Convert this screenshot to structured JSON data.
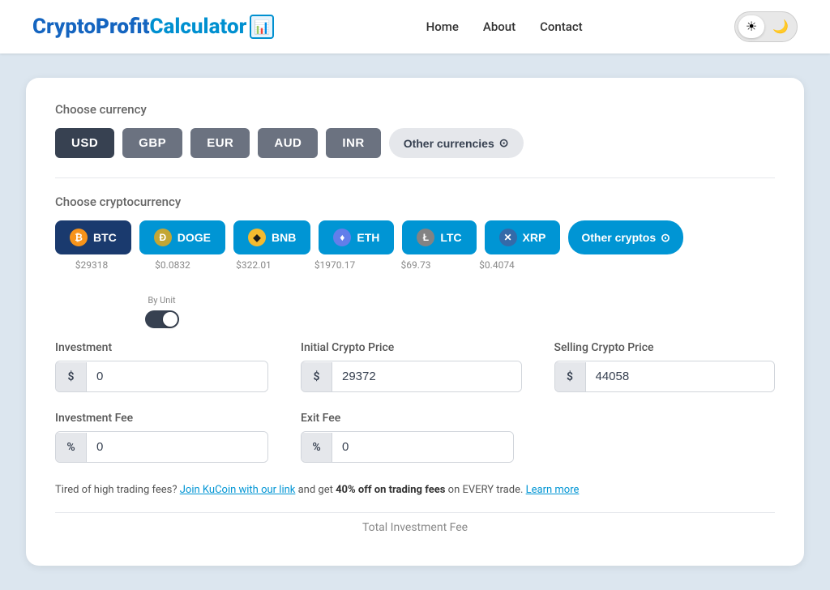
{
  "header": {
    "logo": {
      "crypto": "Crypto",
      "profit": "Profit",
      "calculator": "Calculator",
      "icon": "🖩"
    },
    "nav": [
      {
        "id": "home",
        "label": "Home"
      },
      {
        "id": "about",
        "label": "About"
      },
      {
        "id": "contact",
        "label": "Contact"
      }
    ],
    "theme": {
      "light_icon": "☀",
      "dark_icon": "🌙"
    }
  },
  "currency_section": {
    "label": "Choose currency",
    "buttons": [
      {
        "id": "usd",
        "label": "USD",
        "active": true
      },
      {
        "id": "gbp",
        "label": "GBP",
        "active": false
      },
      {
        "id": "eur",
        "label": "EUR",
        "active": false
      },
      {
        "id": "aud",
        "label": "AUD",
        "active": false
      },
      {
        "id": "inr",
        "label": "INR",
        "active": false
      }
    ],
    "other_label": "Other currencies",
    "other_icon": "⊙"
  },
  "crypto_section": {
    "label": "Choose cryptocurrency",
    "coins": [
      {
        "id": "btc",
        "label": "BTC",
        "price": "$29318",
        "icon": "₿",
        "active": true
      },
      {
        "id": "doge",
        "label": "DOGE",
        "price": "$0.0832",
        "icon": "D",
        "active": false
      },
      {
        "id": "bnb",
        "label": "BNB",
        "price": "$322.01",
        "icon": "◆",
        "active": false
      },
      {
        "id": "eth",
        "label": "ETH",
        "price": "$1970.17",
        "icon": "♦",
        "active": false
      },
      {
        "id": "ltc",
        "label": "LTC",
        "price": "$69.73",
        "icon": "Ł",
        "active": false
      },
      {
        "id": "xrp",
        "label": "XRP",
        "price": "$0.4074",
        "icon": "✕",
        "active": false
      }
    ],
    "other_label": "Other cryptos",
    "other_icon": "⊙"
  },
  "investment": {
    "by_unit_label": "By Unit",
    "label": "Investment",
    "prefix": "$",
    "value": "0",
    "initial_price_label": "Initial Crypto Price",
    "initial_price_prefix": "$",
    "initial_price_value": "29372",
    "selling_price_label": "Selling Crypto Price",
    "selling_price_prefix": "$",
    "selling_price_value": "44058"
  },
  "fees": {
    "investment_fee_label": "Investment Fee",
    "investment_fee_prefix": "%",
    "investment_fee_value": "0",
    "exit_fee_label": "Exit Fee",
    "exit_fee_prefix": "%",
    "exit_fee_value": "0"
  },
  "promo": {
    "text_before": "Tired of high trading fees?",
    "link_text": "Join KuCoin with our link",
    "text_middle": "and get",
    "bold_text": "40% off on trading fees",
    "text_after": "on EVERY trade.",
    "link2_text": "Learn more"
  },
  "total": {
    "label": "Total Investment Fee"
  }
}
